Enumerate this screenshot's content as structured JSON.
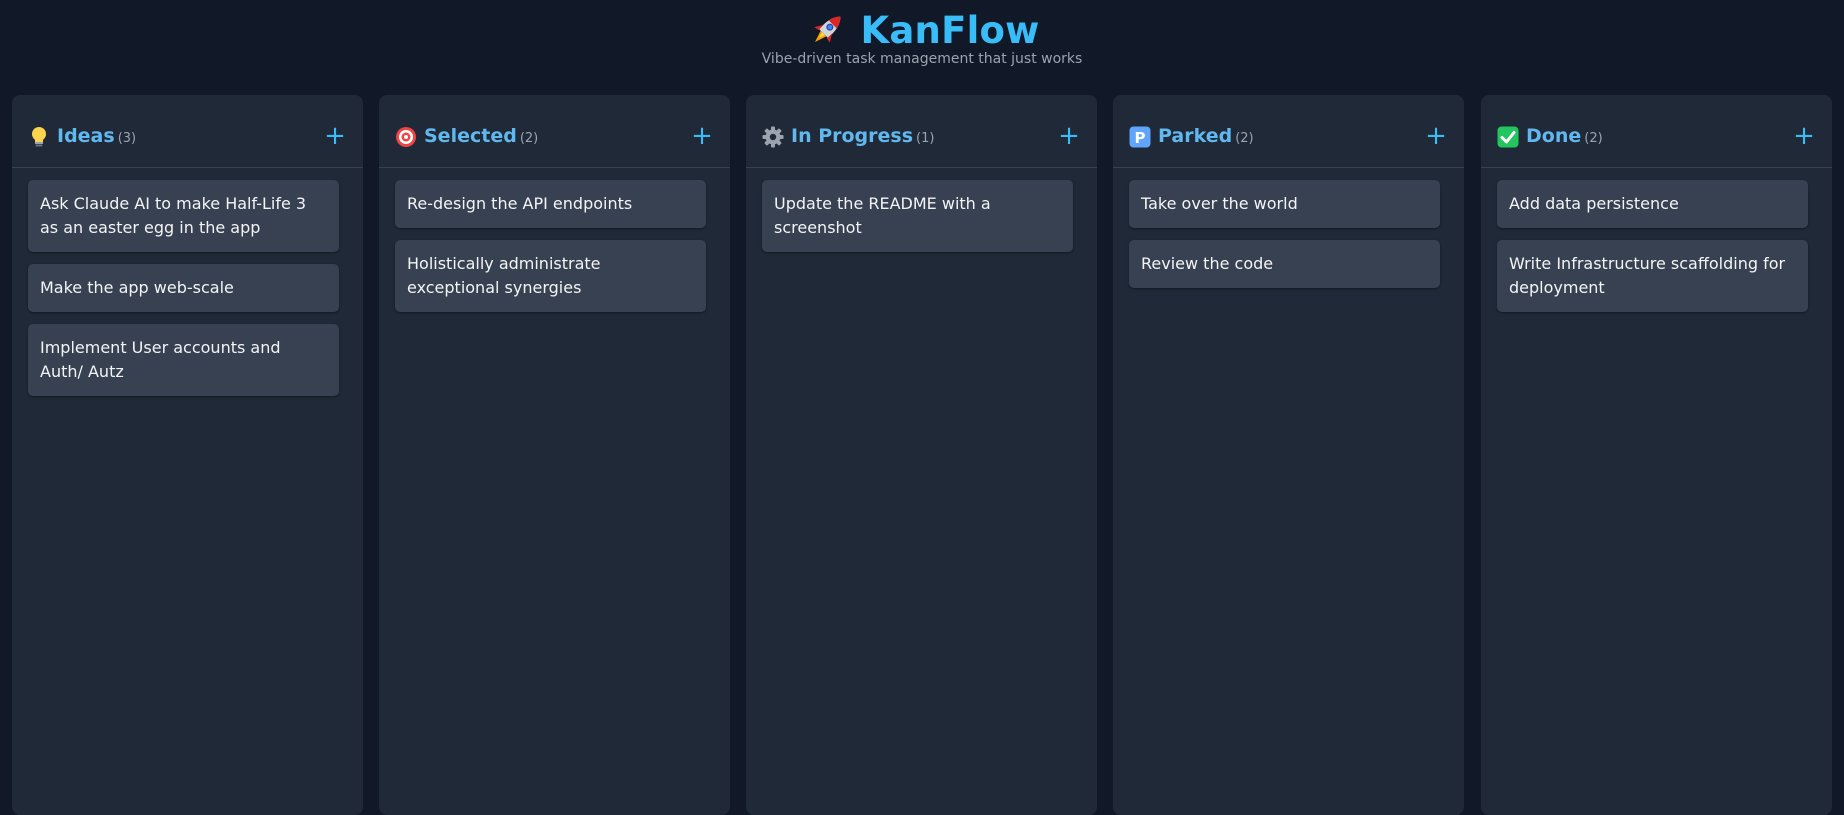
{
  "app": {
    "title": "KanFlow",
    "tagline": "Vibe-driven task management that just works",
    "logo_icon": "rocket-icon",
    "accent_color": "#38bdf8"
  },
  "columns": [
    {
      "icon": "lightbulb-icon",
      "title": "Ideas",
      "count": "(3)",
      "add_label": "+",
      "cards": [
        "Ask Claude AI to make Half-Life 3 as an easter egg in the app",
        "Make the app web-scale",
        "Implement User accounts and Auth/ Autz"
      ]
    },
    {
      "icon": "target-icon",
      "title": "Selected",
      "count": "(2)",
      "add_label": "+",
      "cards": [
        "Re-design the API endpoints",
        "Holistically administrate exceptional synergies"
      ]
    },
    {
      "icon": "gear-icon",
      "title": "In Progress",
      "count": "(1)",
      "add_label": "+",
      "cards": [
        "Update the README with a screenshot"
      ]
    },
    {
      "icon": "parking-icon",
      "title": "Parked",
      "count": "(2)",
      "add_label": "+",
      "cards": [
        "Take over the world",
        "Review the code"
      ]
    },
    {
      "icon": "check-mark-icon",
      "title": "Done",
      "count": "(2)",
      "add_label": "+",
      "cards": [
        "Add data persistence",
        "Write Infrastructure scaffolding for deployment"
      ]
    }
  ]
}
